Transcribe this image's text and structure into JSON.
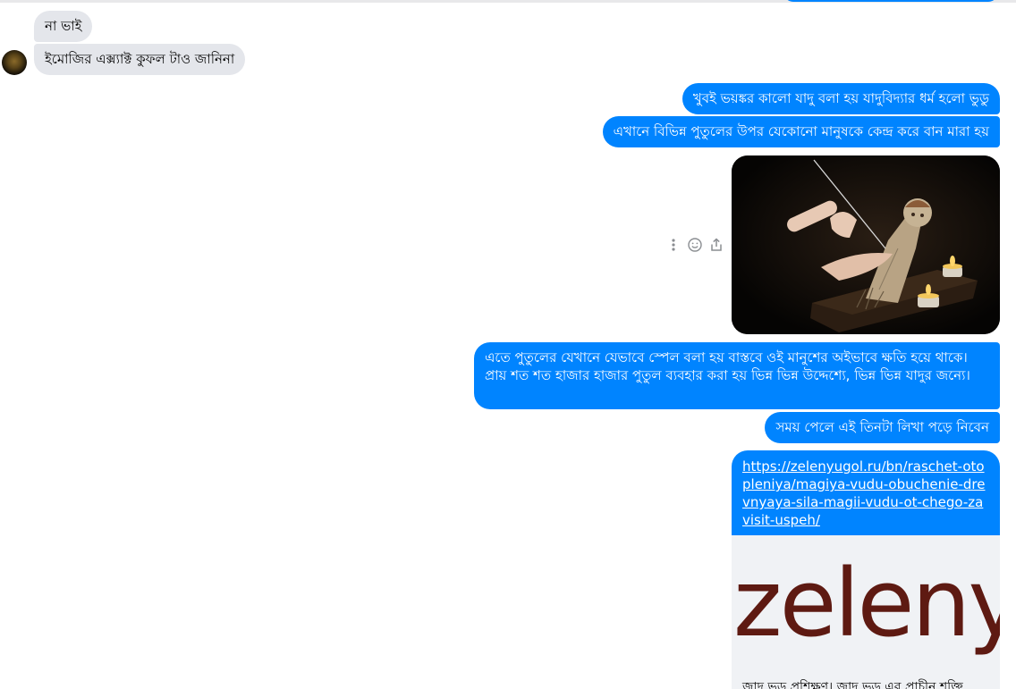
{
  "messages": {
    "incoming": [
      "না ভাই",
      "ইমোজির এক্স্যাক্ট কুফল টাও জানিনা"
    ],
    "outgoing": [
      "খুবই  ভয়ঙ্কর কালো যাদু বলা হয় যাদুবিদ্যার ধর্ম হলো ভুডু",
      "এখানে বিভিন্ন পুতুলের উপর যেকোনো মানুষকে কেন্দ্র করে বান মারা হয়",
      "এতে পুতুলের যেখানে যেভাবে স্পেল বলা হয় বাস্তবে ওই মানুশের অইভাবে ক্ষতি হয়ে থাকে। প্রায় শত শত হাজার হাজার পুতুল ব্যবহার করা হয় ভিন্ন ভিন্ন উদ্দেশ্যে, ভিন্ন ভিন্ন যাদুর জন্যে।",
      "সময় পেলে এই তিনটা লিখা পড়ে নিবেন"
    ],
    "link": {
      "url": "https://zelenyugol.ru/bn/raschet-otopleniya/magiya-vudu-obuchenie-drevnyaya-sila-magii-vudu-ot-chego-zavisit-uspeh/",
      "preview_logo": "zelenyugol",
      "preview_title": "জাদু ভুডু প্রশিক্ষণ। জাদু ভুডু এর প্রাচীন শক্তি"
    },
    "photo_description": "voodoo-doll-with-needle"
  },
  "colors": {
    "outgoing_bubble": "#0084ff",
    "incoming_bubble": "#e4e6eb",
    "logo": "#5e1a12"
  },
  "icons": {
    "more": "more-vertical-icon",
    "react": "smiley-icon",
    "share": "share-icon"
  }
}
